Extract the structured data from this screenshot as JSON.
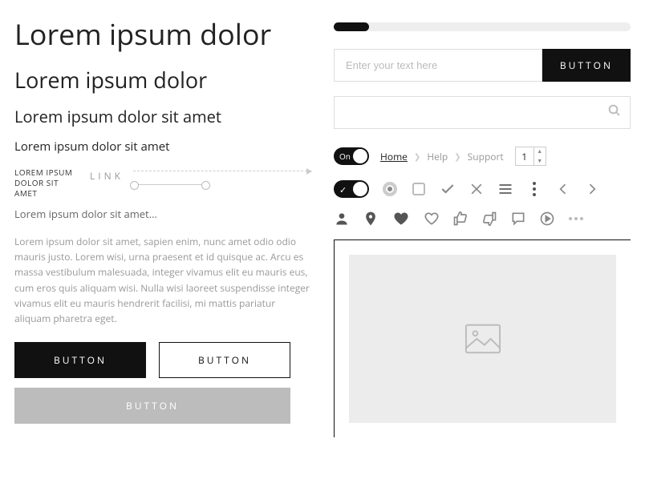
{
  "typography": {
    "h1": "Lorem ipsum dolor",
    "h2": "Lorem ipsum dolor",
    "h3": "Lorem ipsum dolor sit amet",
    "h4": "Lorem ipsum dolor sit amet",
    "caption": "LOREM IPSUM DOLOR SIT AMET",
    "link_label": "LINK",
    "truncated": "Lorem ipsum dolor sit amet...",
    "body": "Lorem ipsum dolor sit amet, sapien enim, nunc amet odio odio mauris justo. Lorem wisi, urna praesent et id quisque ac. Arcu es massa vestibulum malesuada, integer vivamus elit eu mauris eus, cum eros quis aliquam wisi. Nulla wisi laoreet suspendisse integer vivamus elit eu mauris hendrerit facilisi, mi mattis pariatur aliquam pharetra eget."
  },
  "buttons": {
    "primary": "BUTTON",
    "secondary": "BUTTON",
    "wide": "BUTTON",
    "input_button": "BUTTON"
  },
  "input": {
    "placeholder": "Enter your text here"
  },
  "progress": {
    "value_pct": 12
  },
  "toggle": {
    "on_label": "On"
  },
  "breadcrumb": {
    "items": [
      {
        "label": "Home",
        "active": true
      },
      {
        "label": "Help",
        "active": false
      },
      {
        "label": "Support",
        "active": false
      }
    ]
  },
  "stepper": {
    "value": "1"
  }
}
